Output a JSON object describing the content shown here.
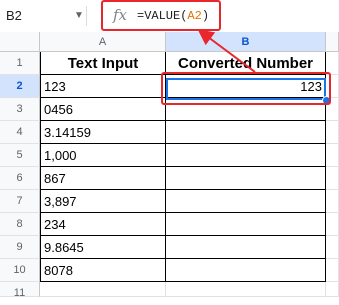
{
  "formula_bar": {
    "name_box": "B2",
    "name_box_caret": "▼",
    "fx_icon": "fx",
    "formula_prefix": "=VALUE(",
    "formula_ref": "A2",
    "formula_suffix": ")"
  },
  "columns": [
    "A",
    "B"
  ],
  "rows": [
    "1",
    "2",
    "3",
    "4",
    "5",
    "6",
    "7",
    "8",
    "9",
    "10",
    "11"
  ],
  "headers": {
    "a1": "Text Input",
    "b1": "Converted Number"
  },
  "data": {
    "a": [
      "123",
      "0456",
      "3.14159",
      "1,000",
      "867",
      "3,897",
      "234",
      "9.8645",
      "8078"
    ],
    "b2": "123"
  },
  "colors": {
    "highlight": "#e8262c",
    "selection": "#1a73e8"
  }
}
